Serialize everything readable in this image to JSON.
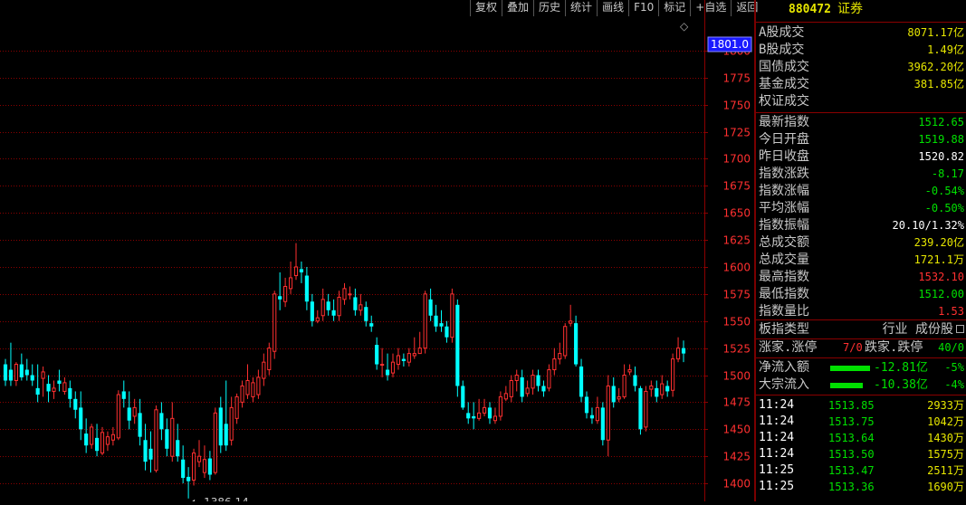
{
  "toolbar": [
    "复权",
    "叠加",
    "历史",
    "统计",
    "画线",
    "F10",
    "标记",
    "+自选",
    "返回"
  ],
  "panel": {
    "code": "880472",
    "name": "证券",
    "turnover": [
      {
        "label": "A股成交",
        "value": "8071.17亿"
      },
      {
        "label": "B股成交",
        "value": "1.49亿"
      },
      {
        "label": "国债成交",
        "value": "3962.20亿"
      },
      {
        "label": "基金成交",
        "value": "381.85亿"
      },
      {
        "label": "权证成交",
        "value": ""
      }
    ],
    "stats": [
      {
        "label": "最新指数",
        "value": "1512.65",
        "color": "#00e000"
      },
      {
        "label": "今日开盘",
        "value": "1519.88",
        "color": "#00e000"
      },
      {
        "label": "昨日收盘",
        "value": "1520.82",
        "color": "#ffffff"
      },
      {
        "label": "指数涨跌",
        "value": "-8.17",
        "color": "#00e000"
      },
      {
        "label": "指数涨幅",
        "value": "-0.54%",
        "color": "#00e000"
      },
      {
        "label": "平均涨幅",
        "value": "-0.50%",
        "color": "#00e000"
      },
      {
        "label": "指数振幅",
        "value": "20.10/1.32%",
        "color": "#ffffff"
      },
      {
        "label": "总成交额",
        "value": "239.20亿",
        "color": "#e6e600"
      },
      {
        "label": "总成交量",
        "value": "1721.1万",
        "color": "#e6e600"
      },
      {
        "label": "最高指数",
        "value": "1532.10",
        "color": "#ff3030"
      },
      {
        "label": "最低指数",
        "value": "1512.00",
        "color": "#00e000"
      },
      {
        "label": "指数量比",
        "value": "1.53",
        "color": "#ff3030"
      }
    ],
    "board_type_label": "板指类型",
    "board_type_value": "行业 成份股",
    "up_label": "涨家.涨停",
    "up_value": "7/0",
    "down_label": "跌家.跌停",
    "down_value": "40/0",
    "net_inflow_label": "净流入额",
    "net_inflow_value": "-12.81亿",
    "net_inflow_pct": "-5%",
    "block_inflow_label": "大宗流入",
    "block_inflow_value": "-10.38亿",
    "block_inflow_pct": "-4%",
    "ticks": [
      {
        "time": "11:24",
        "price": "1513.85",
        "vol": "2933万"
      },
      {
        "time": "11:24",
        "price": "1513.75",
        "vol": "1042万"
      },
      {
        "time": "11:24",
        "price": "1513.64",
        "vol": "1430万"
      },
      {
        "time": "11:24",
        "price": "1513.50",
        "vol": "1575万"
      },
      {
        "time": "11:25",
        "price": "1513.47",
        "vol": "2511万"
      },
      {
        "time": "11:25",
        "price": "1513.36",
        "vol": "1690万"
      }
    ]
  },
  "chart_data": {
    "type": "candlestick",
    "y_ticks": [
      "1800",
      "1775",
      "1750",
      "1725",
      "1700",
      "1675",
      "1650",
      "1625",
      "1600",
      "1575",
      "1550",
      "1525",
      "1500",
      "1475",
      "1450",
      "1425",
      "1400"
    ],
    "ylim": [
      1385,
      1830
    ],
    "current_price_label": "1801.0",
    "min_annotation": "1386.14",
    "colors": {
      "up": "#ff3030",
      "down": "#00ffff",
      "grid": "#8a0000"
    },
    "candles": [
      [
        1510,
        1495,
        1515,
        1490
      ],
      [
        1505,
        1495,
        1530,
        1490
      ],
      [
        1495,
        1510,
        1512,
        1490
      ],
      [
        1510,
        1498,
        1520,
        1495
      ],
      [
        1505,
        1500,
        1515,
        1495
      ],
      [
        1500,
        1495,
        1510,
        1490
      ],
      [
        1488,
        1482,
        1510,
        1475
      ],
      [
        1497,
        1503,
        1508,
        1480
      ],
      [
        1492,
        1485,
        1500,
        1475
      ],
      [
        1485,
        1488,
        1495,
        1478
      ],
      [
        1495,
        1492,
        1505,
        1485
      ],
      [
        1485,
        1493,
        1498,
        1482
      ],
      [
        1488,
        1478,
        1495,
        1470
      ],
      [
        1478,
        1468,
        1485,
        1460
      ],
      [
        1470,
        1450,
        1485,
        1440
      ],
      [
        1446,
        1435,
        1460,
        1428
      ],
      [
        1436,
        1452,
        1455,
        1432
      ],
      [
        1442,
        1430,
        1455,
        1425
      ],
      [
        1428,
        1447,
        1452,
        1426
      ],
      [
        1436,
        1443,
        1448,
        1430
      ],
      [
        1440,
        1445,
        1452,
        1435
      ],
      [
        1442,
        1482,
        1486,
        1440
      ],
      [
        1485,
        1478,
        1495,
        1470
      ],
      [
        1470,
        1458,
        1485,
        1450
      ],
      [
        1462,
        1470,
        1478,
        1455
      ],
      [
        1465,
        1443,
        1478,
        1435
      ],
      [
        1440,
        1420,
        1455,
        1412
      ],
      [
        1432,
        1422,
        1448,
        1410
      ],
      [
        1412,
        1468,
        1472,
        1410
      ],
      [
        1465,
        1450,
        1475,
        1440
      ],
      [
        1450,
        1432,
        1460,
        1425
      ],
      [
        1425,
        1460,
        1475,
        1420
      ],
      [
        1440,
        1425,
        1455,
        1420
      ],
      [
        1422,
        1405,
        1435,
        1400
      ],
      [
        1406,
        1402,
        1415,
        1386
      ],
      [
        1403,
        1428,
        1432,
        1398
      ],
      [
        1420,
        1425,
        1440,
        1415
      ],
      [
        1410,
        1422,
        1435,
        1405
      ],
      [
        1423,
        1408,
        1430,
        1403
      ],
      [
        1410,
        1465,
        1470,
        1408
      ],
      [
        1470,
        1435,
        1480,
        1428
      ],
      [
        1455,
        1435,
        1495,
        1430
      ],
      [
        1440,
        1470,
        1480,
        1435
      ],
      [
        1460,
        1480,
        1483,
        1455
      ],
      [
        1475,
        1490,
        1495,
        1470
      ],
      [
        1482,
        1495,
        1510,
        1478
      ],
      [
        1480,
        1493,
        1498,
        1475
      ],
      [
        1482,
        1498,
        1505,
        1478
      ],
      [
        1497,
        1512,
        1520,
        1490
      ],
      [
        1505,
        1525,
        1530,
        1500
      ],
      [
        1522,
        1575,
        1578,
        1515
      ],
      [
        1573,
        1570,
        1595,
        1560
      ],
      [
        1568,
        1582,
        1590,
        1563
      ],
      [
        1580,
        1590,
        1605,
        1575
      ],
      [
        1592,
        1600,
        1622,
        1588
      ],
      [
        1598,
        1595,
        1605,
        1585
      ],
      [
        1592,
        1568,
        1600,
        1560
      ],
      [
        1568,
        1550,
        1575,
        1545
      ],
      [
        1550,
        1553,
        1560,
        1548
      ],
      [
        1555,
        1570,
        1580,
        1550
      ],
      [
        1568,
        1560,
        1575,
        1555
      ],
      [
        1560,
        1555,
        1570,
        1550
      ],
      [
        1555,
        1572,
        1578,
        1550
      ],
      [
        1570,
        1580,
        1585,
        1565
      ],
      [
        1575,
        1575,
        1582,
        1570
      ],
      [
        1572,
        1560,
        1580,
        1555
      ],
      [
        1560,
        1565,
        1575,
        1555
      ],
      [
        1563,
        1550,
        1568,
        1545
      ],
      [
        1548,
        1545,
        1555,
        1540
      ],
      [
        1528,
        1510,
        1535,
        1505
      ],
      [
        1510,
        1510,
        1525,
        1498
      ],
      [
        1505,
        1500,
        1520,
        1495
      ],
      [
        1502,
        1512,
        1520,
        1498
      ],
      [
        1510,
        1518,
        1525,
        1505
      ],
      [
        1515,
        1513,
        1520,
        1508
      ],
      [
        1512,
        1520,
        1525,
        1508
      ],
      [
        1518,
        1520,
        1535,
        1515
      ],
      [
        1520,
        1525,
        1540,
        1520
      ],
      [
        1525,
        1575,
        1578,
        1520
      ],
      [
        1570,
        1555,
        1580,
        1550
      ],
      [
        1555,
        1545,
        1565,
        1540
      ],
      [
        1548,
        1545,
        1560,
        1540
      ],
      [
        1545,
        1535,
        1550,
        1530
      ],
      [
        1535,
        1575,
        1580,
        1530
      ],
      [
        1565,
        1490,
        1570,
        1480
      ],
      [
        1490,
        1470,
        1495,
        1468
      ],
      [
        1465,
        1460,
        1475,
        1455
      ],
      [
        1462,
        1460,
        1475,
        1450
      ],
      [
        1460,
        1465,
        1478,
        1458
      ],
      [
        1465,
        1470,
        1478,
        1462
      ],
      [
        1470,
        1460,
        1475,
        1455
      ],
      [
        1458,
        1462,
        1470,
        1455
      ],
      [
        1462,
        1480,
        1485,
        1458
      ],
      [
        1478,
        1483,
        1490,
        1476
      ],
      [
        1480,
        1495,
        1500,
        1475
      ],
      [
        1495,
        1500,
        1505,
        1485
      ],
      [
        1498,
        1480,
        1505,
        1475
      ],
      [
        1483,
        1488,
        1495,
        1480
      ],
      [
        1488,
        1500,
        1505,
        1482
      ],
      [
        1500,
        1490,
        1505,
        1485
      ],
      [
        1490,
        1485,
        1495,
        1480
      ],
      [
        1488,
        1505,
        1510,
        1485
      ],
      [
        1505,
        1515,
        1525,
        1500
      ],
      [
        1515,
        1520,
        1530,
        1510
      ],
      [
        1518,
        1545,
        1548,
        1515
      ],
      [
        1548,
        1550,
        1565,
        1545
      ],
      [
        1548,
        1510,
        1555,
        1508
      ],
      [
        1508,
        1480,
        1515,
        1475
      ],
      [
        1480,
        1465,
        1485,
        1460
      ],
      [
        1463,
        1460,
        1470,
        1455
      ],
      [
        1458,
        1470,
        1480,
        1455
      ],
      [
        1470,
        1440,
        1475,
        1435
      ],
      [
        1440,
        1490,
        1500,
        1425
      ],
      [
        1490,
        1475,
        1498,
        1470
      ],
      [
        1478,
        1480,
        1488,
        1475
      ],
      [
        1480,
        1500,
        1510,
        1478
      ],
      [
        1503,
        1505,
        1510,
        1500
      ],
      [
        1500,
        1490,
        1508,
        1485
      ],
      [
        1488,
        1450,
        1490,
        1445
      ],
      [
        1452,
        1485,
        1490,
        1448
      ],
      [
        1487,
        1490,
        1495,
        1480
      ],
      [
        1488,
        1480,
        1495,
        1475
      ],
      [
        1482,
        1492,
        1500,
        1478
      ],
      [
        1490,
        1485,
        1495,
        1480
      ],
      [
        1486,
        1515,
        1520,
        1480
      ],
      [
        1515,
        1525,
        1535,
        1512
      ],
      [
        1525,
        1520,
        1532,
        1512
      ]
    ]
  }
}
